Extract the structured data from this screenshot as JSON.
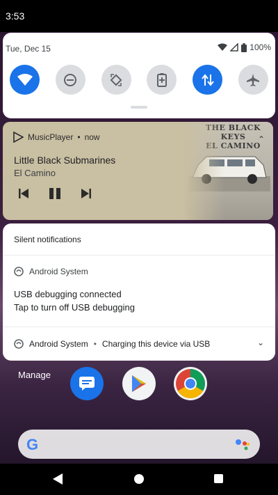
{
  "status_bar": {
    "time": "3:53"
  },
  "quick_settings": {
    "date": "Tue, Dec 15",
    "battery_percent": "100%",
    "tiles": [
      {
        "name": "wifi",
        "active": true
      },
      {
        "name": "do-not-disturb",
        "active": false
      },
      {
        "name": "auto-rotate",
        "active": false
      },
      {
        "name": "battery-saver",
        "active": false
      },
      {
        "name": "mobile-data",
        "active": true
      },
      {
        "name": "airplane-mode",
        "active": false
      }
    ]
  },
  "media": {
    "app": "MusicPlayer",
    "time": "now",
    "title": "Little Black Submarines",
    "album": "El Camino",
    "album_art_text": "THE BLACK KEYS\nEL CAMINO"
  },
  "silent": {
    "header": "Silent notifications",
    "notification1": {
      "app": "Android System",
      "title": "USB debugging connected",
      "text": "Tap to turn off USB debugging"
    },
    "notification2": {
      "app": "Android System",
      "text": "Charging this device via USB"
    }
  },
  "manage_label": "Manage",
  "colors": {
    "accent": "#1a73e8",
    "media_bg": "#c9bfa2"
  }
}
